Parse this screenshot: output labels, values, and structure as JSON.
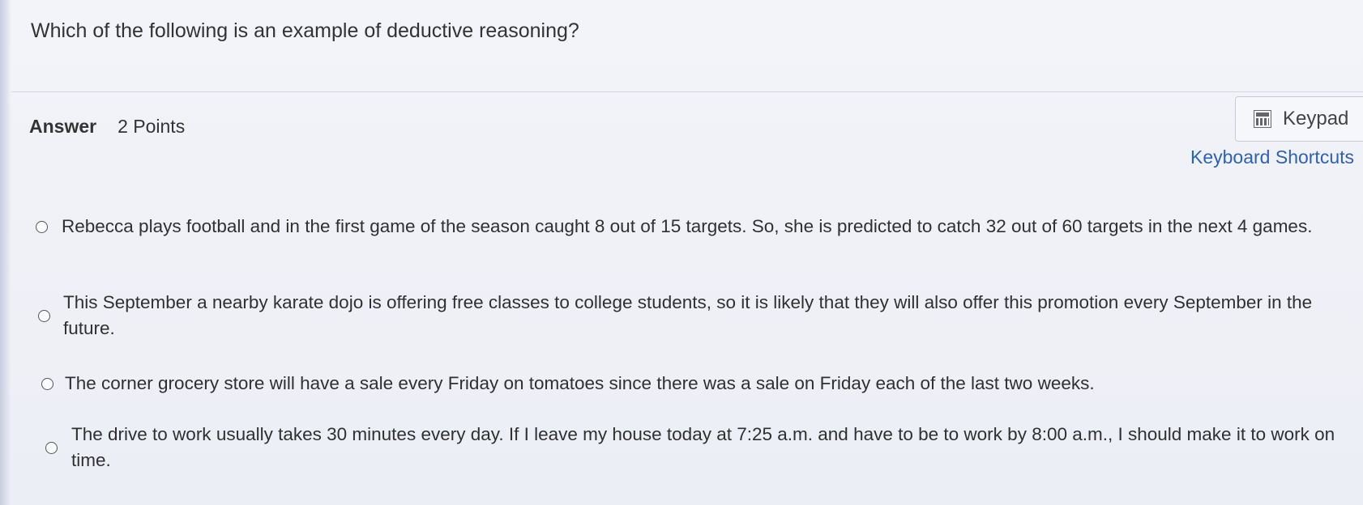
{
  "question": {
    "text": "Which of the following is an example of deductive reasoning?"
  },
  "answer": {
    "label": "Answer",
    "points": "2 Points"
  },
  "toolbar": {
    "keypad_label": "Keypad",
    "keypad_icon": "calculator-icon",
    "shortcuts_label": "Keyboard Shortcuts"
  },
  "options": [
    {
      "text": "Rebecca plays football and in the first game of the season caught 8 out of 15 targets. So, she is predicted to catch 32 out of 60 targets in the next 4 games.",
      "selected": false
    },
    {
      "text": "This September a nearby karate dojo is offering free classes to college students, so it is likely that they will also offer this promotion every September in the future.",
      "selected": false
    },
    {
      "text": "The corner grocery store will have a sale every Friday on tomatoes since there was a sale on Friday each of the last two weeks.",
      "selected": false
    },
    {
      "text": "The drive to work usually takes 30 minutes every day. If I leave my house today at 7:25 a.m. and have to be to work by 8:00 a.m., I should make it to work on time.",
      "selected": false
    }
  ],
  "colors": {
    "link": "#2c62b4",
    "background": "#eef0f6",
    "text": "#303030"
  }
}
